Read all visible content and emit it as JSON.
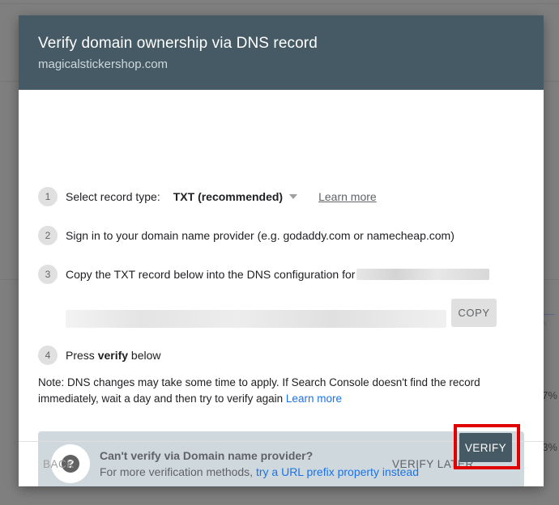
{
  "backdrop": {
    "pct_1": "7%",
    "pct_2": "3%"
  },
  "dialog": {
    "title": "Verify domain ownership via DNS record",
    "subtitle": "magicalstickershop.com"
  },
  "steps": [
    {
      "number": "1",
      "label": "Select record type:"
    },
    {
      "number": "2",
      "label": "Sign in to your domain name provider (e.g. godaddy.com or namecheap.com)"
    },
    {
      "number": "3",
      "label": "Copy the TXT record below into the DNS configuration for"
    },
    {
      "number": "4",
      "label_prefix": "Press ",
      "label_bold": "verify",
      "label_suffix": " below"
    }
  ],
  "record_type": {
    "selected": "TXT (recommended)",
    "learn_more": "Learn more"
  },
  "copy_button": "COPY",
  "note": {
    "text": "Note: DNS changes may take some time to apply. If Search Console doesn't find the record immediately, wait a day and then try to verify again",
    "link": "Learn more"
  },
  "alternative": {
    "title": "Can't verify via Domain name provider?",
    "text": "For more verification methods,",
    "link": "try a URL prefix property instead"
  },
  "footer": {
    "back": "BACK",
    "verify_later": "VERIFY LATER",
    "verify": "VERIFY"
  },
  "colors": {
    "header_bg": "#455a64",
    "link": "#1a73e8",
    "highlight": "#e00000",
    "alt_box_bg": "#cfd8dc"
  }
}
